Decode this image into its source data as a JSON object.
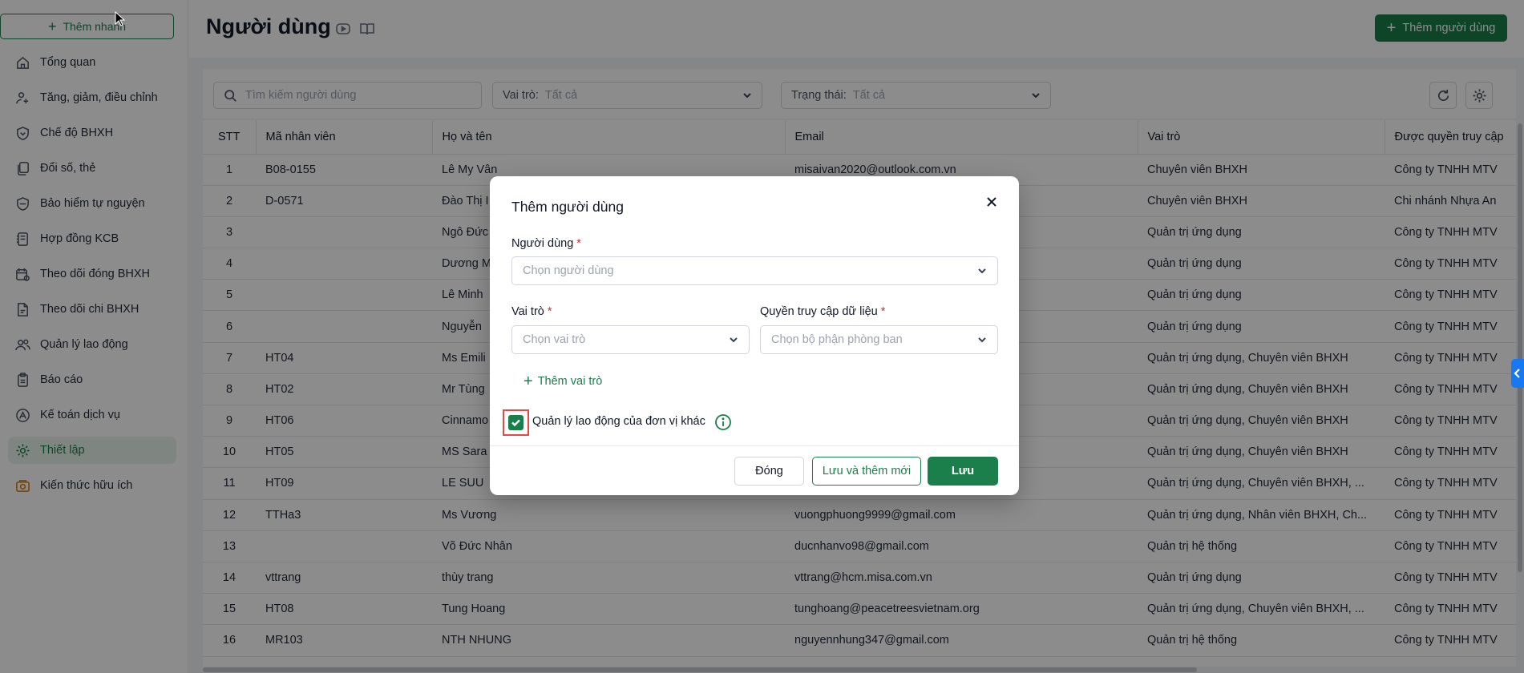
{
  "sidebar": {
    "add_group_label": "Thêm nhanh",
    "items": [
      {
        "label": "Tổng quan",
        "icon": "home-icon"
      },
      {
        "label": "Tăng, giảm, điều chỉnh",
        "icon": "user-plus-icon"
      },
      {
        "label": "Chế độ BHXH",
        "icon": "shield-heart-icon"
      },
      {
        "label": "Đổi số, thẻ",
        "icon": "copy-icon"
      },
      {
        "label": "Bảo hiểm tự nguyện",
        "icon": "shield-icon"
      },
      {
        "label": "Hợp đồng KCB",
        "icon": "notebook-icon"
      },
      {
        "label": "Theo dõi đóng BHXH",
        "icon": "calendar-money-icon"
      },
      {
        "label": "Theo dõi chi BHXH",
        "icon": "document-money-icon"
      },
      {
        "label": "Quản lý lao động",
        "icon": "users-icon"
      },
      {
        "label": "Báo cáo",
        "icon": "clipboard-icon"
      },
      {
        "label": "Kế toán dịch vụ",
        "icon": "service-icon"
      },
      {
        "label": "Thiết lập",
        "icon": "gear-icon",
        "active": true
      },
      {
        "label": "Kiến thức hữu ích",
        "icon": "knowledge-icon"
      }
    ]
  },
  "header": {
    "title": "Người dùng",
    "add_user_label": "Thêm người dùng"
  },
  "filters": {
    "search_placeholder": "Tìm kiếm người dùng",
    "role_label": "Vai trò:",
    "role_value": "Tất cả",
    "status_label": "Trạng thái:",
    "status_value": "Tất cả"
  },
  "table": {
    "columns": [
      "STT",
      "Mã nhân viên",
      "Họ và tên",
      "Email",
      "Vai trò",
      "Được quyền truy cập"
    ],
    "rows": [
      [
        "1",
        "B08-0155",
        "Lê My Vân",
        "misaivan2020@outlook.com.vn",
        "Chuyên viên BHXH",
        "Công ty TNHH MTV"
      ],
      [
        "2",
        "D-0571",
        "Đào Thị I",
        "",
        "Chuyên viên BHXH",
        "Chi nhánh Nhựa An"
      ],
      [
        "3",
        "",
        "Ngô Đức",
        "",
        "Quản trị ứng dụng",
        "Công ty TNHH MTV"
      ],
      [
        "4",
        "",
        "Dương M",
        "",
        "Quản trị ứng dụng",
        "Công ty TNHH MTV"
      ],
      [
        "5",
        "",
        "Lê Minh",
        "",
        "Quản trị ứng dụng",
        "Công ty TNHH MTV"
      ],
      [
        "6",
        "",
        "Nguyễn",
        "",
        "Quản trị ứng dụng",
        "Công ty TNHH MTV"
      ],
      [
        "7",
        "HT04",
        "Ms Emili",
        "",
        "Quản trị ứng dụng, Chuyên viên BHXH",
        "Công ty TNHH MTV"
      ],
      [
        "8",
        "HT02",
        "Mr Tùng",
        "",
        "Quản trị ứng dụng, Chuyên viên BHXH",
        "Công ty TNHH MTV"
      ],
      [
        "9",
        "HT06",
        "Cinnamo",
        "",
        "Quản trị ứng dụng, Chuyên viên BHXH",
        "Công ty TNHH MTV"
      ],
      [
        "10",
        "HT05",
        "MS Sara",
        "",
        "Quản trị ứng dụng, Chuyên viên BHXH",
        "Công ty TNHH MTV"
      ],
      [
        "11",
        "HT09",
        "LE SUU",
        "",
        "Quản trị ứng dụng, Chuyên viên BHXH, ...",
        "Công ty TNHH MTV"
      ],
      [
        "12",
        "TTHa3",
        "Ms Vương",
        "vuongphuong9999@gmail.com",
        "Quản trị ứng dụng, Nhân viên BHXH, Ch...",
        "Công ty TNHH MTV"
      ],
      [
        "13",
        "",
        "Võ Đức Nhân",
        "ducnhanvo98@gmail.com",
        "Quản trị hệ thống",
        "Công ty TNHH MTV"
      ],
      [
        "14",
        "vttrang",
        "thùy trang",
        "vttrang@hcm.misa.com.vn",
        "Quản trị ứng dụng",
        "Công ty TNHH MTV"
      ],
      [
        "15",
        "HT08",
        "Tung Hoang",
        "tunghoang@peacetreesvietnam.org",
        "Quản trị ứng dụng, Chuyên viên BHXH, ...",
        "Công ty TNHH MTV"
      ],
      [
        "16",
        "MR103",
        "NTH NHUNG",
        "nguyennhung347@gmail.com",
        "Quản trị hệ thống",
        "Công ty TNHH MTV"
      ]
    ]
  },
  "modal": {
    "title": "Thêm người dùng",
    "user_label": "Người dùng",
    "user_placeholder": "Chọn người dùng",
    "role_label": "Vai trò",
    "role_placeholder": "Chọn vai trò",
    "access_label": "Quyền truy cập dữ liệu",
    "access_placeholder": "Chọn bộ phận phòng ban",
    "add_role_label": "Thêm vai trò",
    "manage_other_label": "Quản lý lao động của đơn vị khác",
    "manage_other_checked": true,
    "close_label": "Đóng",
    "save_new_label": "Lưu và thêm mới",
    "save_label": "Lưu"
  },
  "colors": {
    "brand": "#1a7f4b",
    "required": "#dc2626",
    "highlight": "#ef4444",
    "side_tab": "#1877f2"
  }
}
